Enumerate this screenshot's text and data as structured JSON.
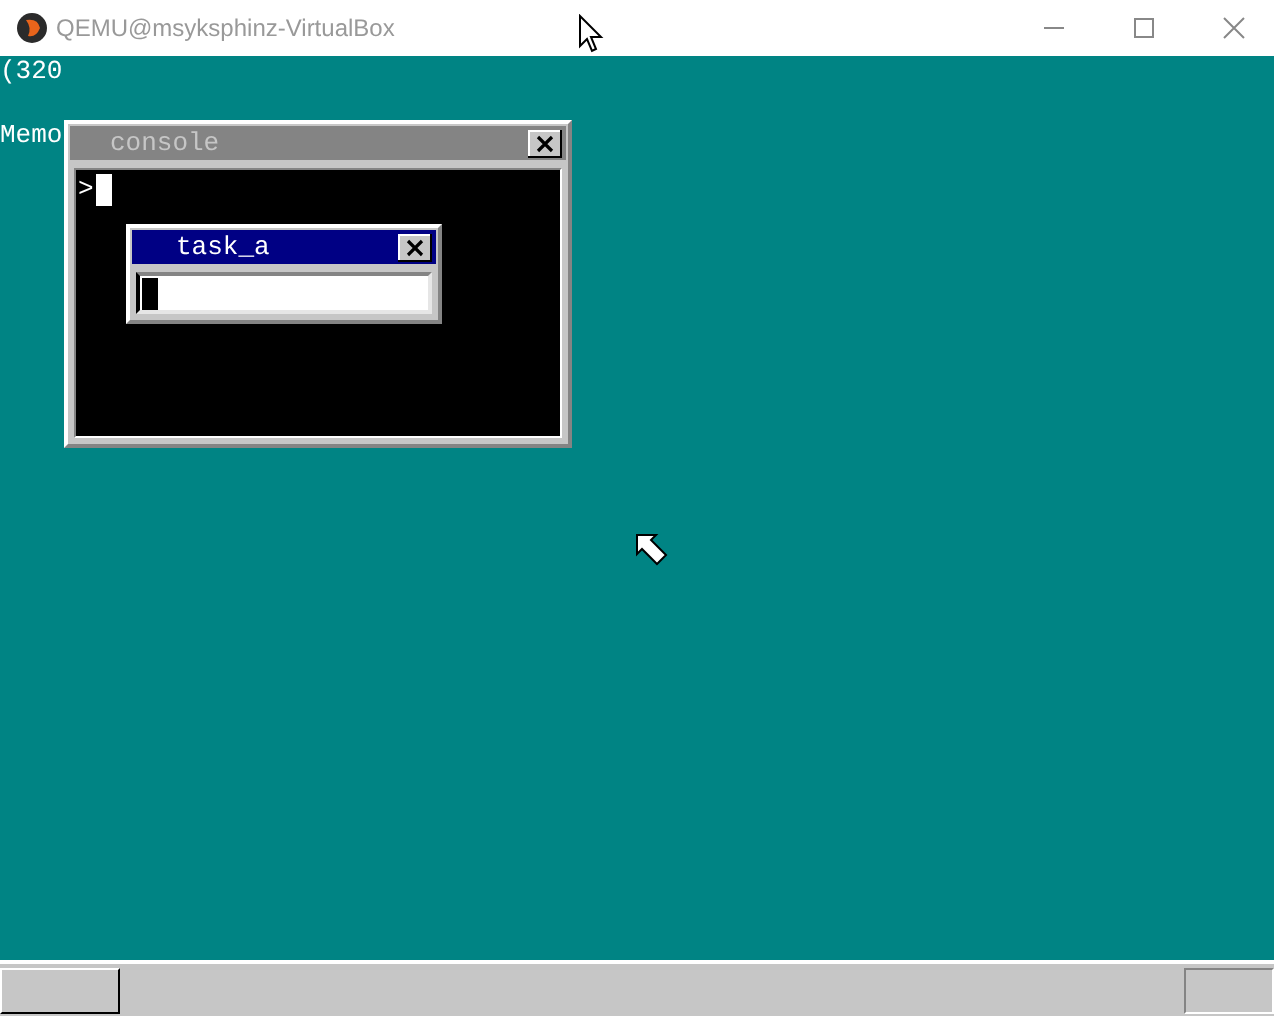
{
  "window": {
    "title": "QEMU@msyksphinz-VirtualBox"
  },
  "desktop": {
    "texts": [
      "(320",
      "Memo"
    ],
    "windows": [
      {
        "title": "console",
        "active": false,
        "kind": "console",
        "prompt": ">"
      },
      {
        "title": "task_a",
        "active": true,
        "kind": "textbox"
      }
    ]
  }
}
